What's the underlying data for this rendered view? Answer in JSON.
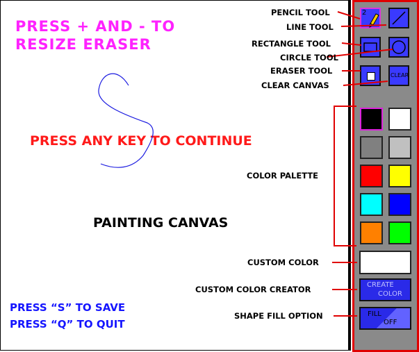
{
  "canvas": {
    "resize_hint": [
      "PRESS + AND - TO",
      "RESIZE ERASER"
    ],
    "continue_text": "PRESS ANY KEY TO CONTINUE",
    "title": "PAINTING CANVAS",
    "save_hint": "PRESS “S” TO SAVE",
    "quit_hint": "PRESS “Q” TO QUIT",
    "stroke_color": "#1a1ae0"
  },
  "labels": {
    "pencil": "PENCIL TOOL",
    "line": "LINE TOOL",
    "rectangle": "RECTANGLE TOOL",
    "circle": "CIRCLE TOOL",
    "eraser": "ERASER TOOL",
    "clear": "CLEAR CANVAS",
    "palette": "COLOR PALETTE",
    "custom_color": "CUSTOM COLOR",
    "custom_creator": "CUSTOM COLOR CREATOR",
    "shape_fill": "SHAPE FILL OPTION"
  },
  "tools": {
    "clear_label": "CLEAR",
    "create_color_lines": [
      "CREATE",
      "COLOR"
    ],
    "fill_lines": [
      "FILL",
      "OFF"
    ],
    "pencil_size": "2"
  },
  "palette": [
    "#000000",
    "#ffffff",
    "#808080",
    "#c0c0c0",
    "#ff0000",
    "#ffff00",
    "#00ffff",
    "#0000ff",
    "#ff8000",
    "#00ff00"
  ],
  "custom_color": "#ffffff",
  "colors": {
    "accent_red": "#e00000",
    "sidebar": "#8a8a8a",
    "tool_blue": "#3a3aff"
  }
}
